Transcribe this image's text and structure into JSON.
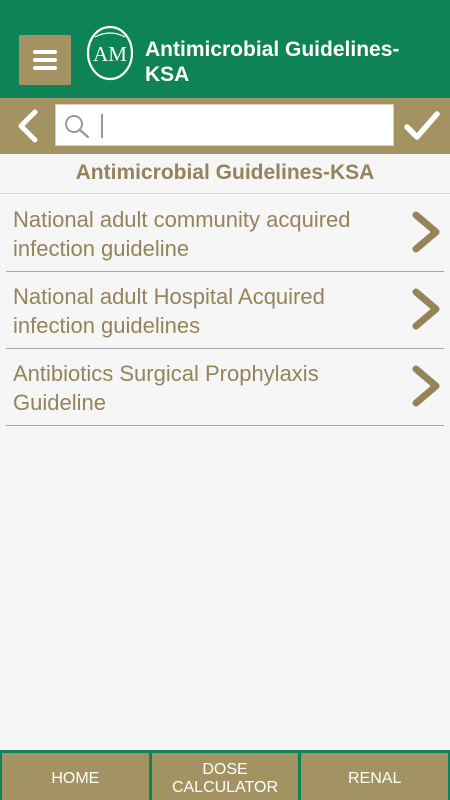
{
  "app": {
    "title": "Antimicrobial Guidelines-KSA",
    "logo_text": "AM"
  },
  "icons": {
    "menu": "hamburger-menu-icon",
    "back": "chevron-left-icon",
    "search": "magnifier-icon",
    "confirm": "checkmark-icon",
    "item_arrow": "chevron-right-icon"
  },
  "search": {
    "value": "",
    "placeholder": ""
  },
  "section": {
    "title": "Antimicrobial Guidelines-KSA"
  },
  "items": [
    {
      "label": "National adult community acquired infection guideline"
    },
    {
      "label": "National adult Hospital Acquired infection guidelines"
    },
    {
      "label": "Antibiotics Surgical Prophylaxis Guideline"
    }
  ],
  "bottom_nav": [
    {
      "label": "HOME"
    },
    {
      "label": "DOSE CALCULATOR"
    },
    {
      "label": "RENAL"
    }
  ],
  "colors": {
    "primary_green": "#0f8358",
    "accent_gold": "#a39363",
    "text_gold": "#95845a",
    "background": "#f6f6f6"
  }
}
